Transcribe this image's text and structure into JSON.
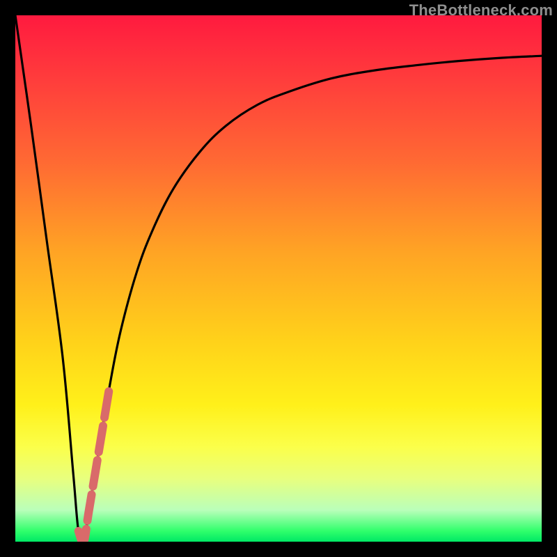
{
  "watermark": "TheBottleneck.com",
  "colors": {
    "frame": "#000000",
    "curve": "#000000",
    "marker": "#d96a6a",
    "gradient_top": "#ff1a3f",
    "gradient_bottom": "#00e865"
  },
  "chart_data": {
    "type": "line",
    "title": "",
    "xlabel": "",
    "ylabel": "",
    "xlim": [
      0,
      100
    ],
    "ylim": [
      0,
      100
    ],
    "grid": false,
    "series": [
      {
        "name": "bottleneck-curve",
        "x": [
          0,
          3,
          6,
          9,
          11,
          12,
          13,
          14,
          16,
          18,
          20,
          23,
          26,
          30,
          35,
          40,
          46,
          52,
          60,
          68,
          76,
          84,
          92,
          100
        ],
        "values": [
          100,
          79,
          57,
          35,
          13,
          2,
          0,
          6,
          18,
          30,
          40,
          51,
          59,
          67,
          74,
          79,
          83,
          85.5,
          88,
          89.5,
          90.5,
          91.3,
          91.9,
          92.3
        ]
      }
    ],
    "highlight_segment": {
      "series": "bottleneck-curve",
      "start_index": 5,
      "end_index": 9
    }
  }
}
